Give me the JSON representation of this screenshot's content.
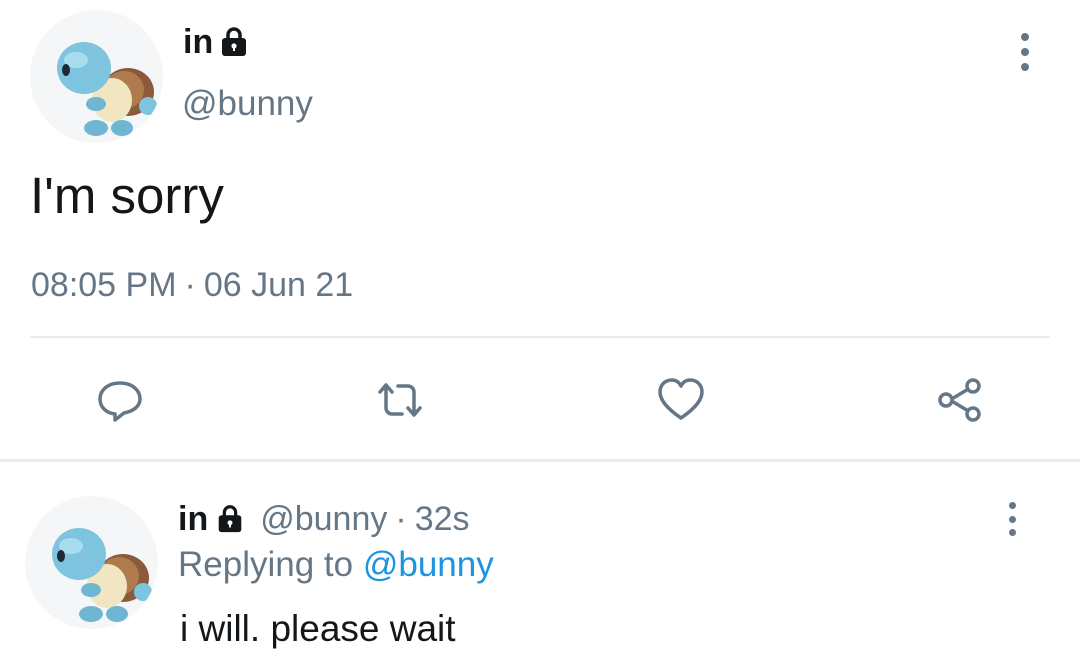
{
  "main_tweet": {
    "display_name": "in",
    "handle": "@bunny",
    "text": "I'm sorry",
    "time": "08:05 PM",
    "separator": "·",
    "date": "06 Jun 21"
  },
  "actions": {
    "reply": "reply-icon",
    "retweet": "retweet-icon",
    "like": "heart-icon",
    "share": "share-icon"
  },
  "reply_tweet": {
    "display_name": "in",
    "handle": "@bunny",
    "separator": "·",
    "age": "32s",
    "replying_to_label": "Replying to",
    "replying_to_handle": "@bunny",
    "text": "i will. please wait"
  },
  "colors": {
    "text_primary": "#14171a",
    "text_secondary": "#657786",
    "link": "#1b95e0",
    "divider": "#e6ecf0",
    "avatar_bg": "#f4f6f7"
  }
}
